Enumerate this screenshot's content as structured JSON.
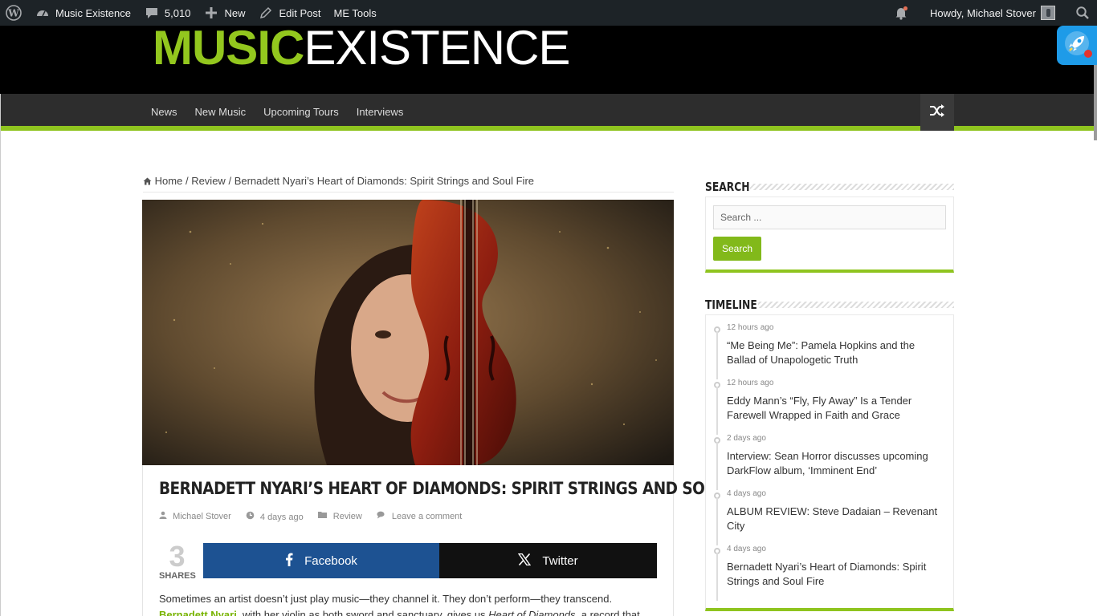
{
  "adminbar": {
    "site_name": "Music Existence",
    "comments_count": "5,010",
    "new_label": "New",
    "edit_label": "Edit Post",
    "tools_label": "ME Tools",
    "greeting": "Howdy, Michael Stover"
  },
  "logo": {
    "part1": "MUSIC",
    "part2": "EXISTENCE"
  },
  "nav": {
    "items": [
      "News",
      "New Music",
      "Upcoming Tours",
      "Interviews"
    ]
  },
  "breadcrumb": {
    "home": "Home",
    "sep": "/",
    "category": "Review",
    "current": "Bernadett Nyari’s Heart of Diamonds: Spirit Strings and Soul Fire"
  },
  "post": {
    "title": "Bernadett Nyari’s Heart of Diamonds: Spirit Strings and Soul Fire",
    "author": "Michael Stover",
    "date": "4 days ago",
    "category": "Review",
    "comment_link": "Leave a comment",
    "shares_count": "3",
    "shares_label": "SHARES",
    "facebook_label": "Facebook",
    "twitter_label": "Twitter",
    "intro": "Sometimes an artist doesn’t just play music—they channel it. They don’t perform—they transcend.",
    "line2_link": "Bernadett Nyari",
    "line2_text": ", with her violin as both sword and sanctuary, gives us ",
    "line2_italic": "Heart of Diamonds",
    "line2_rest": ", a record that"
  },
  "sidebar": {
    "search_title": "Search",
    "search_placeholder": "Search ...",
    "search_button": "Search",
    "timeline_title": "Timeline",
    "timeline": [
      {
        "time": "12 hours ago",
        "title": "“Me Being Me”: Pamela Hopkins and the Ballad of Unapologetic Truth"
      },
      {
        "time": "12 hours ago",
        "title": "Eddy Mann’s “Fly, Fly Away” Is a Tender Farewell Wrapped in Faith and Grace"
      },
      {
        "time": "2 days ago",
        "title": "Interview: Sean Horror discusses upcoming DarkFlow album, ‘Imminent End’"
      },
      {
        "time": "4 days ago",
        "title": "ALBUM REVIEW: Steve Dadaian – Revenant City"
      },
      {
        "time": "4 days ago",
        "title": "Bernadett Nyari’s Heart of Diamonds: Spirit Strings and Soul Fire"
      }
    ]
  },
  "colors": {
    "accent": "#8fc41f",
    "adminbar": "#1d2327",
    "facebook": "#1d5292",
    "twitter": "#111111"
  }
}
